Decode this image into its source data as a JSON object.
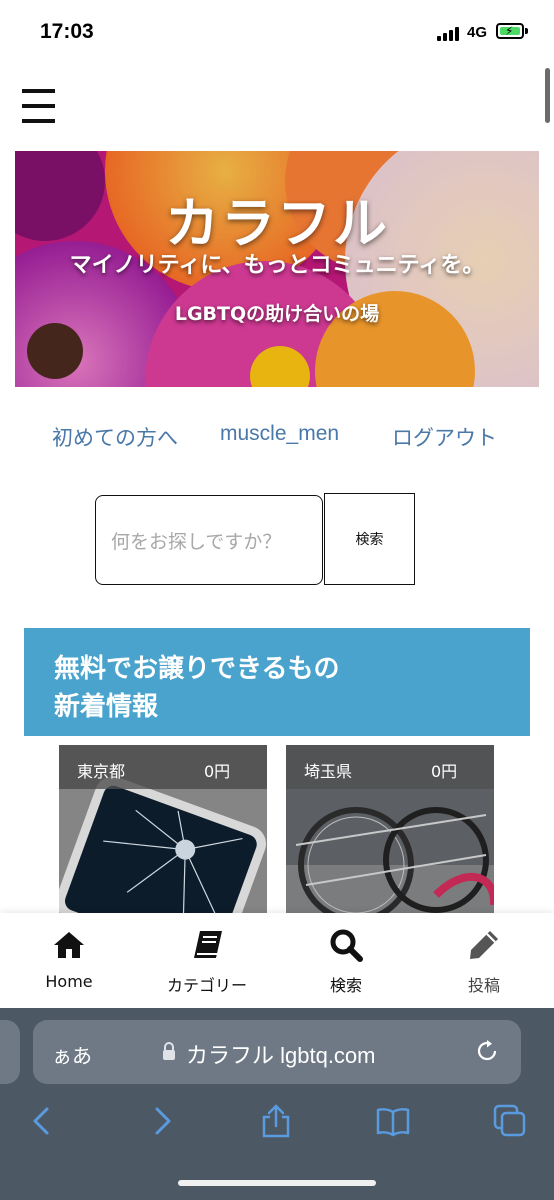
{
  "status_bar": {
    "time": "17:03",
    "network": "4G"
  },
  "banner": {
    "title": "カラフル",
    "tagline": "マイノリティに、もっとコミュニティを。",
    "subtitle": "LGBTQの助け合いの場"
  },
  "nav": {
    "links": [
      "初めての方へ",
      "muscle_men",
      "ログアウト"
    ]
  },
  "search": {
    "placeholder": "何をお探しですか？",
    "button_label": "検索"
  },
  "section": {
    "title_line1": "無料でお譲りできるもの",
    "title_line2": "新着情報"
  },
  "items": [
    {
      "location": "東京都",
      "price": "0円"
    },
    {
      "location": "埼玉県",
      "price": "0円"
    }
  ],
  "tabbar": {
    "tabs": [
      {
        "label": "Home",
        "icon": "home-icon"
      },
      {
        "label": "カテゴリー",
        "icon": "book-icon"
      },
      {
        "label": "検索",
        "icon": "search-icon"
      },
      {
        "label": "投稿",
        "icon": "pencil-icon"
      }
    ]
  },
  "browser": {
    "aa_label": "ぁあ",
    "url": "カラフル lgbtq.com"
  },
  "colors": {
    "link": "#4a78a8",
    "section_header": "#4aa3cc",
    "browser_chrome": "#4c5864",
    "browser_icon": "#5a9be0"
  }
}
